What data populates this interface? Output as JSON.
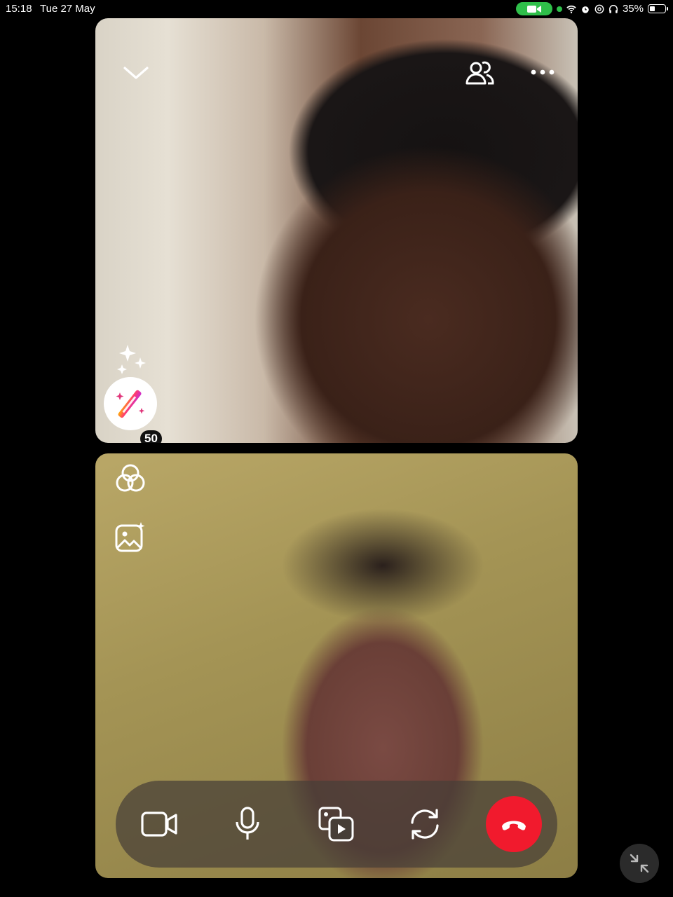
{
  "status_bar": {
    "time": "15:18",
    "date": "Tue 27 May",
    "battery": "35%",
    "battery_level": 0.35
  },
  "remote_video": {
    "effects_count": "50"
  },
  "colors": {
    "end_call": "#f11a2d",
    "active_call": "#2fbf4a"
  },
  "icons": [
    "chevron-down-icon",
    "people-icon",
    "more-icon",
    "sparkles-icon",
    "magic-wand-icon",
    "filters-icon",
    "image-sparkle-icon",
    "camera-icon",
    "microphone-icon",
    "share-media-icon",
    "switch-camera-icon",
    "end-call-icon",
    "minimize-icon"
  ]
}
